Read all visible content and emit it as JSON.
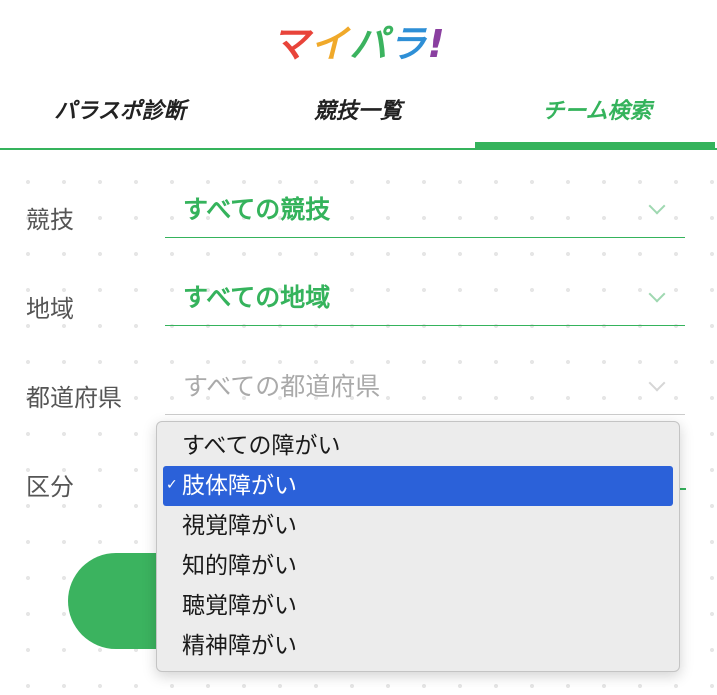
{
  "header": {
    "logo": [
      "マ",
      "イ",
      "パ",
      "ラ",
      "!"
    ],
    "logo_colors": [
      "#e8443a",
      "#f0a92a",
      "#3bb35f",
      "#2e8fd6",
      "#8a3fa0"
    ],
    "tabs": [
      {
        "label": "パラスポ診断",
        "active": false
      },
      {
        "label": "競技一覧",
        "active": false
      },
      {
        "label": "チーム検索",
        "active": true
      }
    ]
  },
  "form": {
    "sport": {
      "label": "競技",
      "value": "すべての競技"
    },
    "region": {
      "label": "地域",
      "value": "すべての地域"
    },
    "prefecture": {
      "label": "都道府県",
      "value": "すべての都道府県"
    },
    "category": {
      "label": "区分"
    }
  },
  "dropdown": {
    "options": [
      {
        "label": "すべての障がい",
        "selected": false
      },
      {
        "label": "肢体障がい",
        "selected": true
      },
      {
        "label": "視覚障がい",
        "selected": false
      },
      {
        "label": "知的障がい",
        "selected": false
      },
      {
        "label": "聴覚障がい",
        "selected": false
      },
      {
        "label": "精神障がい",
        "selected": false
      }
    ],
    "check_glyph": "✓"
  },
  "colors": {
    "accent": "#35b35c",
    "selection": "#2b61d9"
  }
}
